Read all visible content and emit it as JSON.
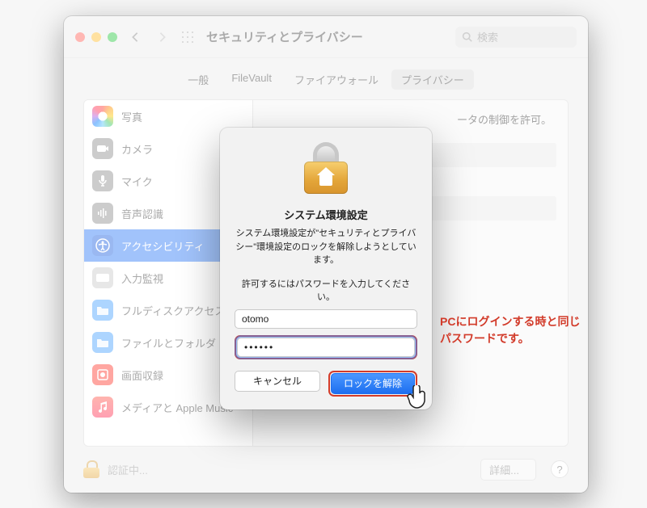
{
  "window": {
    "title": "セキュリティとプライバシー",
    "search_placeholder": "検索"
  },
  "tabs": [
    {
      "label": "一般"
    },
    {
      "label": "FileVault"
    },
    {
      "label": "ファイアウォール"
    },
    {
      "label": "プライバシー",
      "selected": true
    }
  ],
  "sidebar": {
    "items": [
      {
        "label": "写真",
        "icon": "photos",
        "color": "#ffffff"
      },
      {
        "label": "カメラ",
        "icon": "camera",
        "color": "#9b9b9b"
      },
      {
        "label": "マイク",
        "icon": "mic",
        "color": "#9b9b9b"
      },
      {
        "label": "音声認識",
        "icon": "speech",
        "color": "#9b9b9b"
      },
      {
        "label": "アクセシビリティ",
        "icon": "accessibility",
        "color": "#2f7af6",
        "selected": true
      },
      {
        "label": "入力監視",
        "icon": "input",
        "color": "#c9c9c9"
      },
      {
        "label": "フルディスクアクセス",
        "icon": "folder",
        "color": "#4aa3ff"
      },
      {
        "label": "ファイルとフォルダ",
        "icon": "folder",
        "color": "#4aa3ff"
      },
      {
        "label": "画面収録",
        "icon": "screen",
        "color": "#ff3b30"
      },
      {
        "label": "メディアと Apple Music",
        "icon": "music",
        "color": "#ff3b30"
      }
    ]
  },
  "content": {
    "heading_fragment": "ータの制御を許可。"
  },
  "footer": {
    "status": "認証中...",
    "details": "詳細..."
  },
  "dialog": {
    "title": "システム環境設定",
    "message": "システム環境設定が\"セキュリティとプライバシー\"環境設定のロックを解除しようとしています。",
    "prompt": "許可するにはパスワードを入力してください。",
    "username": "otomo",
    "password_masked": "••••••",
    "cancel": "キャンセル",
    "unlock": "ロックを解除"
  },
  "annotation": "PCにログインする時と同じパスワードです。"
}
